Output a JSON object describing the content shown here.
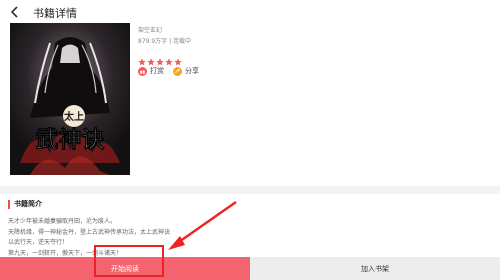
{
  "header": {
    "title": "书籍详情",
    "back_icon": "chevron-left-icon"
  },
  "book": {
    "cover_text_top": "太上",
    "cover_text_main": "武神诀",
    "genre": "架空玄幻",
    "meta": "879.9万字 | 连载中",
    "rating": 5,
    "star_color": "#f05b5b",
    "actions": {
      "reward_label": "打赏",
      "share_label": "分享"
    }
  },
  "intro": {
    "title": "书籍简介",
    "lines": [
      "天才少年被未婚妻骗取丹田，沦为废人。",
      "天降机缘，得一神秘金丹，登上古武神传承功法，太上武神诀",
      "以武行天，逆天夺行！",
      "第九天，一剑斩开，傲天下，一剑斗诸天！"
    ]
  },
  "bottom": {
    "start_label": "开始阅读",
    "shelf_label": "加入书架",
    "accent": "#f4646e"
  },
  "annotation": {
    "color": "#ee2222"
  }
}
